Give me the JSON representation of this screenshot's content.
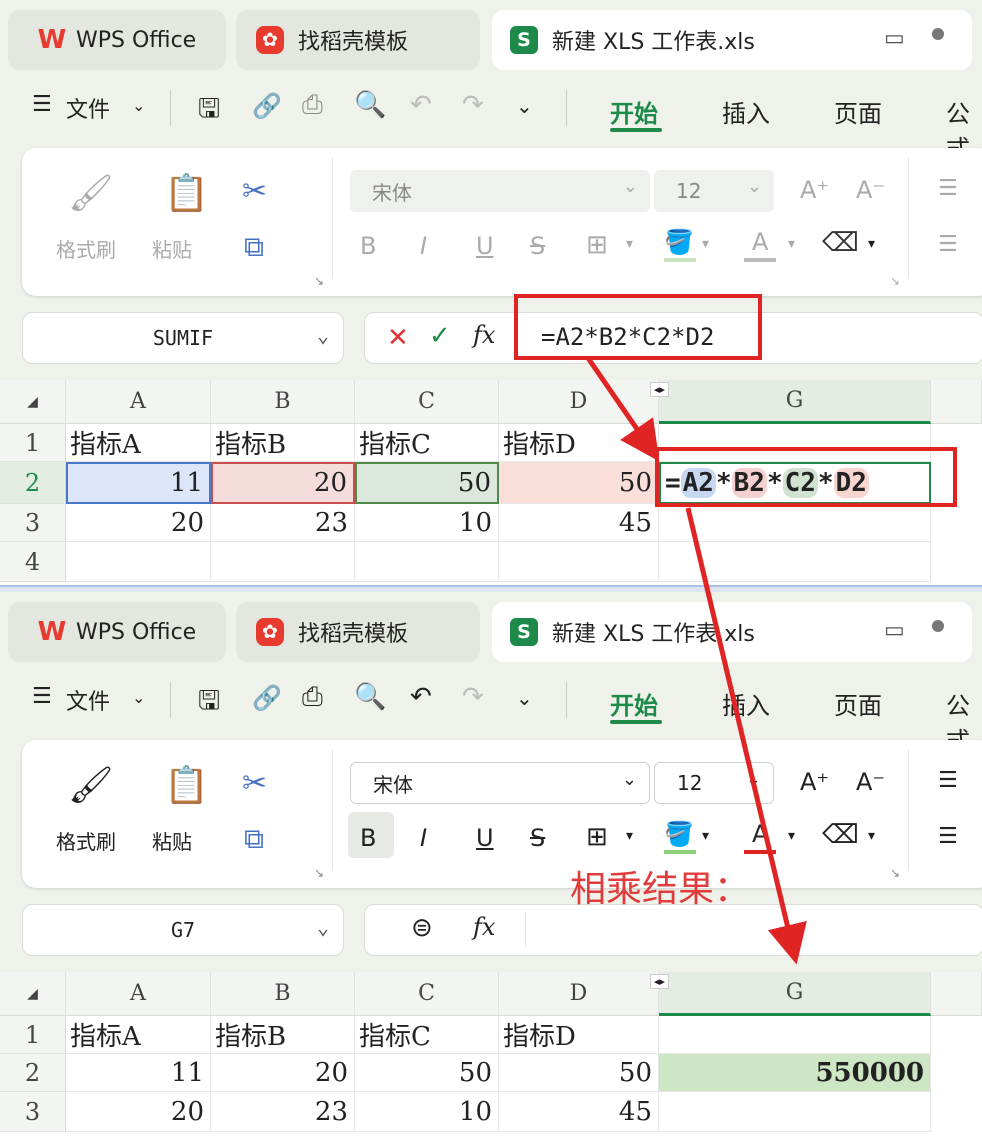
{
  "tabs": {
    "wps": "WPS Office",
    "template": "找稻壳模板",
    "file": "新建 XLS 工作表.xls"
  },
  "menu": {
    "file": "文件",
    "items": [
      "开始",
      "插入",
      "页面",
      "公式"
    ]
  },
  "ribbon": {
    "format_painter": "格式刷",
    "paste": "粘贴",
    "font": "宋体",
    "size": "12",
    "bold": "B",
    "italic": "I",
    "underline": "U",
    "strike": "S",
    "fontcolor": "A",
    "grow": "A⁺",
    "shrink": "A⁻"
  },
  "top": {
    "namebox": "SUMIF",
    "formula": "=A2*B2*C2*D2",
    "g_edit": {
      "eq": "=",
      "a": "A2",
      "b": "B2",
      "c": "C2",
      "d": "D2",
      "op": "*"
    }
  },
  "bottom": {
    "namebox": "G7",
    "result": "550000",
    "annotation": "相乘结果："
  },
  "fx_label": "fx",
  "columns": [
    "A",
    "B",
    "C",
    "D",
    "G"
  ],
  "rows": [
    "1",
    "2",
    "3",
    "4"
  ],
  "sheet": {
    "headers": [
      "指标A",
      "指标B",
      "指标C",
      "指标D"
    ],
    "row2": [
      "11",
      "20",
      "50",
      "50"
    ],
    "row3": [
      "20",
      "23",
      "10",
      "45"
    ]
  },
  "colors": {
    "accent": "#1e8a4a",
    "red": "#e02424",
    "blue_tint": "#dce6f8",
    "red_tint": "#f7dcdc",
    "green_tint": "#dde8dc",
    "salmon_tint": "#f9ded9",
    "result_bg": "#cde6c4"
  }
}
